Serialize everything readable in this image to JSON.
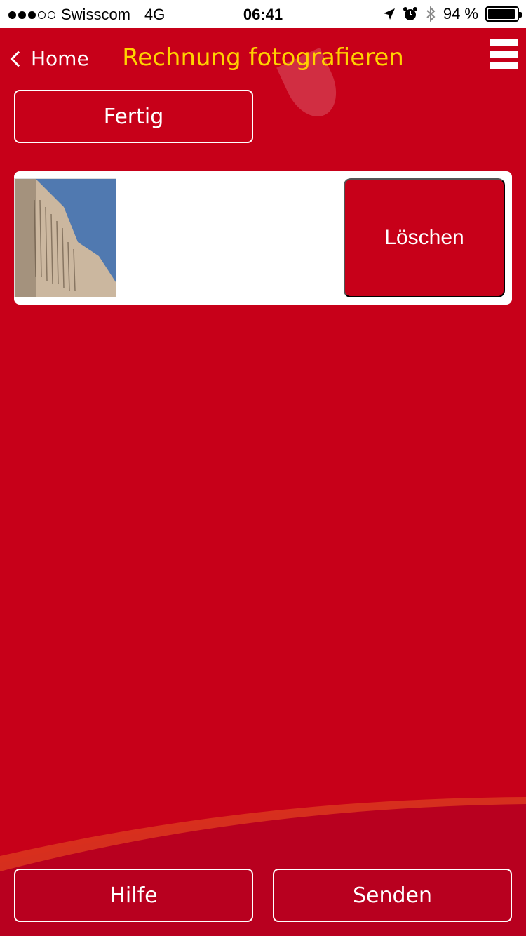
{
  "status_bar": {
    "carrier": "Swisscom",
    "network": "4G",
    "time": "06:41",
    "battery": "94 %",
    "battery_level": 0.94
  },
  "nav": {
    "back_label": "Home",
    "title": "Rechnung fotografieren",
    "title_color": "#ffd200"
  },
  "actions": {
    "done_label": "Fertig",
    "delete_label": "Löschen"
  },
  "footer": {
    "help_label": "Hilfe",
    "send_label": "Senden"
  },
  "colors": {
    "background": "#c70019",
    "accent": "#ffd200"
  },
  "icons": [
    "location-arrow-icon",
    "alarm-icon",
    "bluetooth-icon",
    "battery-icon",
    "hamburger-menu-icon",
    "chevron-left-icon"
  ]
}
